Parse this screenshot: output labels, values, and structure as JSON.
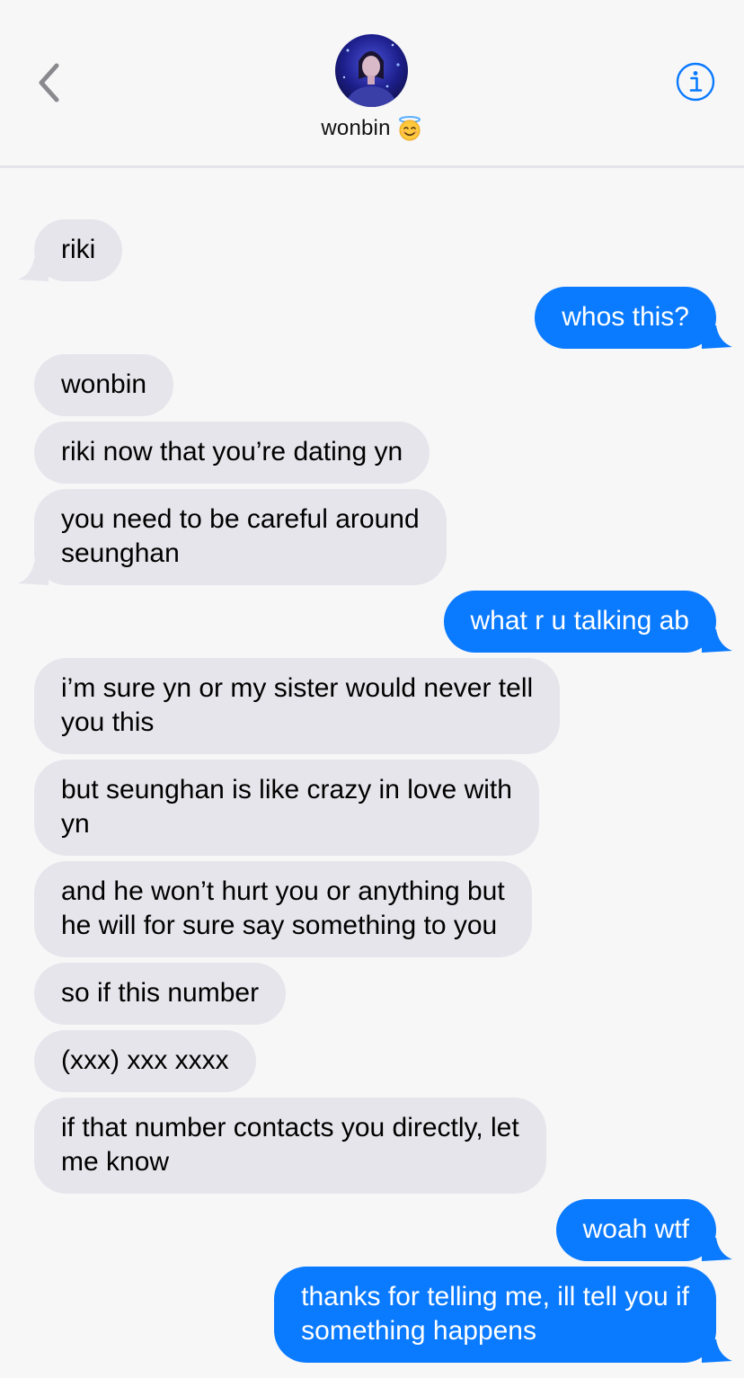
{
  "header": {
    "contact_name": "wonbin",
    "contact_emoji": "smiling-face-with-halo",
    "back_icon": "chevron-left-icon",
    "info_icon": "info-icon"
  },
  "colors": {
    "sent_bubble": "#0a7aff",
    "received_bubble": "#e6e5eb",
    "background": "#f7f7f8",
    "accent": "#0a7aff"
  },
  "messages": [
    {
      "direction": "received",
      "text": "riki",
      "tail": true
    },
    {
      "direction": "sent",
      "text": "whos this?",
      "tail": true
    },
    {
      "direction": "received",
      "text": "wonbin",
      "tail": false
    },
    {
      "direction": "received",
      "text": "riki now that you’re dating yn",
      "tail": false
    },
    {
      "direction": "received",
      "text": "you need to be careful around\nseunghan",
      "tail": true
    },
    {
      "direction": "sent",
      "text": "what r u talking ab",
      "tail": true
    },
    {
      "direction": "received",
      "text": "i’m sure yn or my sister would never tell\nyou this",
      "tail": false
    },
    {
      "direction": "received",
      "text": "but seunghan is like crazy in love with\nyn",
      "tail": false
    },
    {
      "direction": "received",
      "text": "and he won’t hurt you or anything but\nhe will for sure say something to you",
      "tail": false
    },
    {
      "direction": "received",
      "text": "so if this number",
      "tail": false
    },
    {
      "direction": "received",
      "text": "(xxx) xxx xxxx",
      "tail": false
    },
    {
      "direction": "received",
      "text": "if that number contacts you directly, let\nme know",
      "tail": false
    },
    {
      "direction": "sent",
      "text": "woah wtf",
      "tail": true
    },
    {
      "direction": "sent",
      "text": "thanks for telling me, ill tell you if\nsomething happens",
      "tail": true
    }
  ]
}
